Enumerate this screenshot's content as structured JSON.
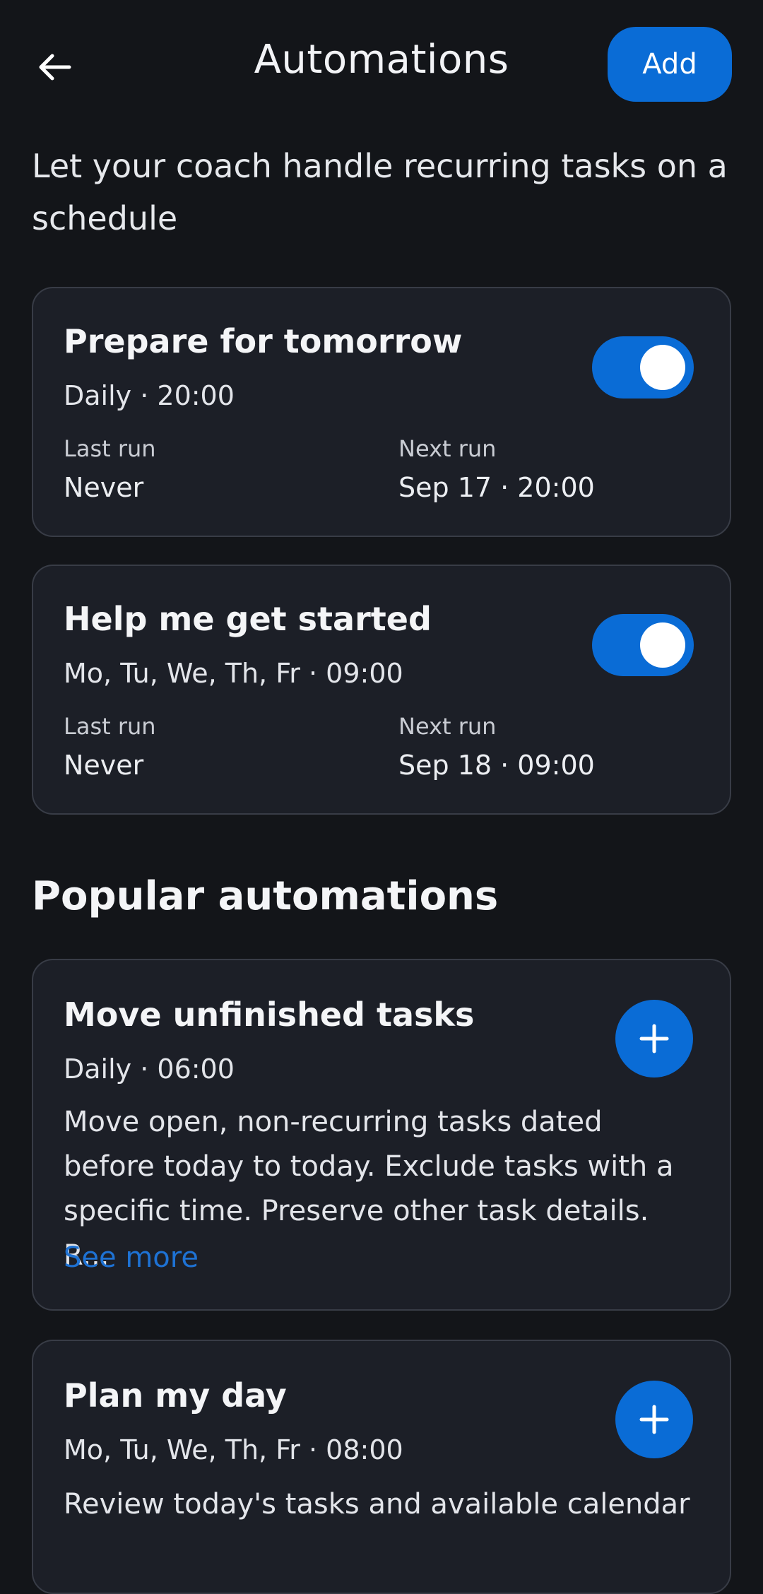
{
  "header": {
    "title": "Automations",
    "add_label": "Add"
  },
  "intro": "Let your coach handle recurring tasks on a schedule",
  "automations": [
    {
      "title": "Prepare for tomorrow",
      "schedule": "Daily · 20:00",
      "enabled": true,
      "last_run_label": "Last run",
      "last_run": "Never",
      "next_run_label": "Next run",
      "next_run": "Sep 17 · 20:00"
    },
    {
      "title": "Help me get started",
      "schedule": "Mo, Tu, We, Th, Fr · 09:00",
      "enabled": true,
      "last_run_label": "Last run",
      "last_run": "Never",
      "next_run_label": "Next run",
      "next_run": "Sep 18 · 09:00"
    }
  ],
  "popular": {
    "title": "Popular automations",
    "items": [
      {
        "title": "Move unfinished tasks",
        "schedule": "Daily · 06:00",
        "description_lines": [
          "Move open, non-recurring tasks dated",
          "before today to today. Exclude tasks with a",
          "specific time. Preserve other task details. R..."
        ],
        "see_more": "See more"
      },
      {
        "title": "Plan my day",
        "schedule": "Mo, Tu, We, Th, Fr · 08:00",
        "description_lines": [
          "Review today's tasks and available calendar"
        ]
      }
    ]
  },
  "colors": {
    "background": "#131519",
    "card": "#1c1f27",
    "accent": "#0a6cd6",
    "link": "#1e72d4"
  },
  "icons": {
    "back": "arrow-left-icon",
    "add": "plus-icon"
  }
}
